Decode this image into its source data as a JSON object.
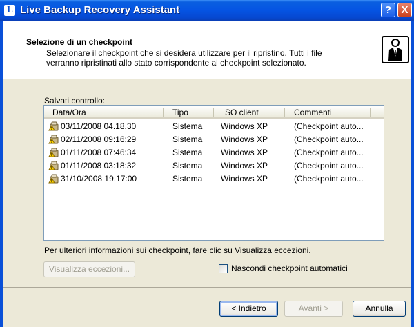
{
  "window": {
    "title": "Live Backup Recovery Assistant",
    "app_icon_letter": "L",
    "help_glyph": "?",
    "close_glyph": "X"
  },
  "header": {
    "title": "Selezione di un checkpoint",
    "description": "Selezionare il checkpoint che si desidera utilizzare per il ripristino. Tutti i file verranno ripristinati allo stato corrispondente al checkpoint selezionato.",
    "icon": "wizard-person-icon"
  },
  "list": {
    "label": "Salvati controllo:",
    "columns": [
      "Data/Ora",
      "Tipo",
      "SO client",
      "Commenti"
    ],
    "rows": [
      {
        "date": "03/11/2008 04.18.30",
        "type": "Sistema",
        "os": "Windows XP",
        "comment": "(Checkpoint auto..."
      },
      {
        "date": "02/11/2008 09:16:29",
        "type": "Sistema",
        "os": "Windows XP",
        "comment": "(Checkpoint auto..."
      },
      {
        "date": "01/11/2008 07:46:34",
        "type": "Sistema",
        "os": "Windows XP",
        "comment": "(Checkpoint auto..."
      },
      {
        "date": "01/11/2008 03:18:32",
        "type": "Sistema",
        "os": "Windows XP",
        "comment": "(Checkpoint auto..."
      },
      {
        "date": "31/10/2008 19.17:00",
        "type": "Sistema",
        "os": "Windows XP",
        "comment": "(Checkpoint auto..."
      }
    ],
    "row_icon": "checkpoint-warning-icon"
  },
  "info": "Per ulteriori informazioni sui checkpoint, fare clic su Visualizza eccezioni.",
  "buttons": {
    "view_exceptions": "Visualizza eccezioni...",
    "back": "< Indietro",
    "next": "Avanti >",
    "cancel": "Annulla"
  },
  "hide_auto": {
    "label": "Nascondi checkpoint automatici",
    "checked": false
  },
  "colors": {
    "titlebar": "#0554e3",
    "face": "#ece9d8",
    "border": "#7f9db9"
  }
}
